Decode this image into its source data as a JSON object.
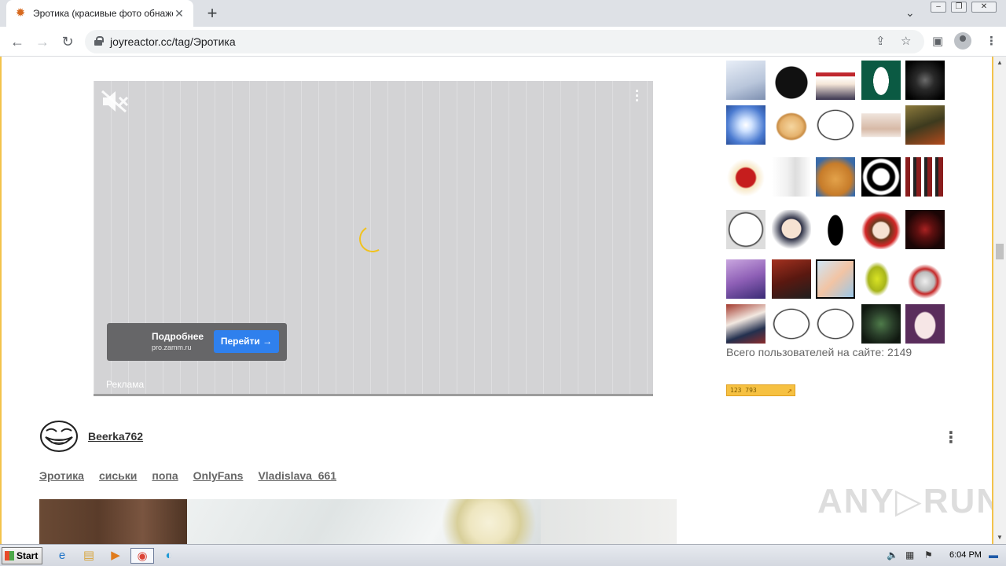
{
  "browser": {
    "tab": {
      "title": "Эротика (красивые фото обнажен",
      "favicon": "joyreactor-favicon"
    },
    "new_tab_label": "+",
    "url": "joyreactor.cc/tag/Эротика"
  },
  "ad": {
    "cta_title": "Подробнее",
    "cta_domain": "pro.zamm.ru",
    "cta_button": "Перейти",
    "label": "Реклама"
  },
  "post": {
    "username": "Beerka762",
    "tags": [
      "Эротика",
      "сиськи",
      "попа",
      "OnlyFans",
      "Vladislava_661"
    ]
  },
  "sidebar": {
    "online_label": "Всего пользователей на сайте: 2149",
    "counter_value": "123 793"
  },
  "watermark": "ANY▷RUN",
  "taskbar": {
    "start_label": "Start",
    "clock": "6:04 PM"
  },
  "colors": {
    "page_border": "#f3c34b",
    "cta_button": "#2f80ed",
    "spinner": "#f1c21d"
  }
}
